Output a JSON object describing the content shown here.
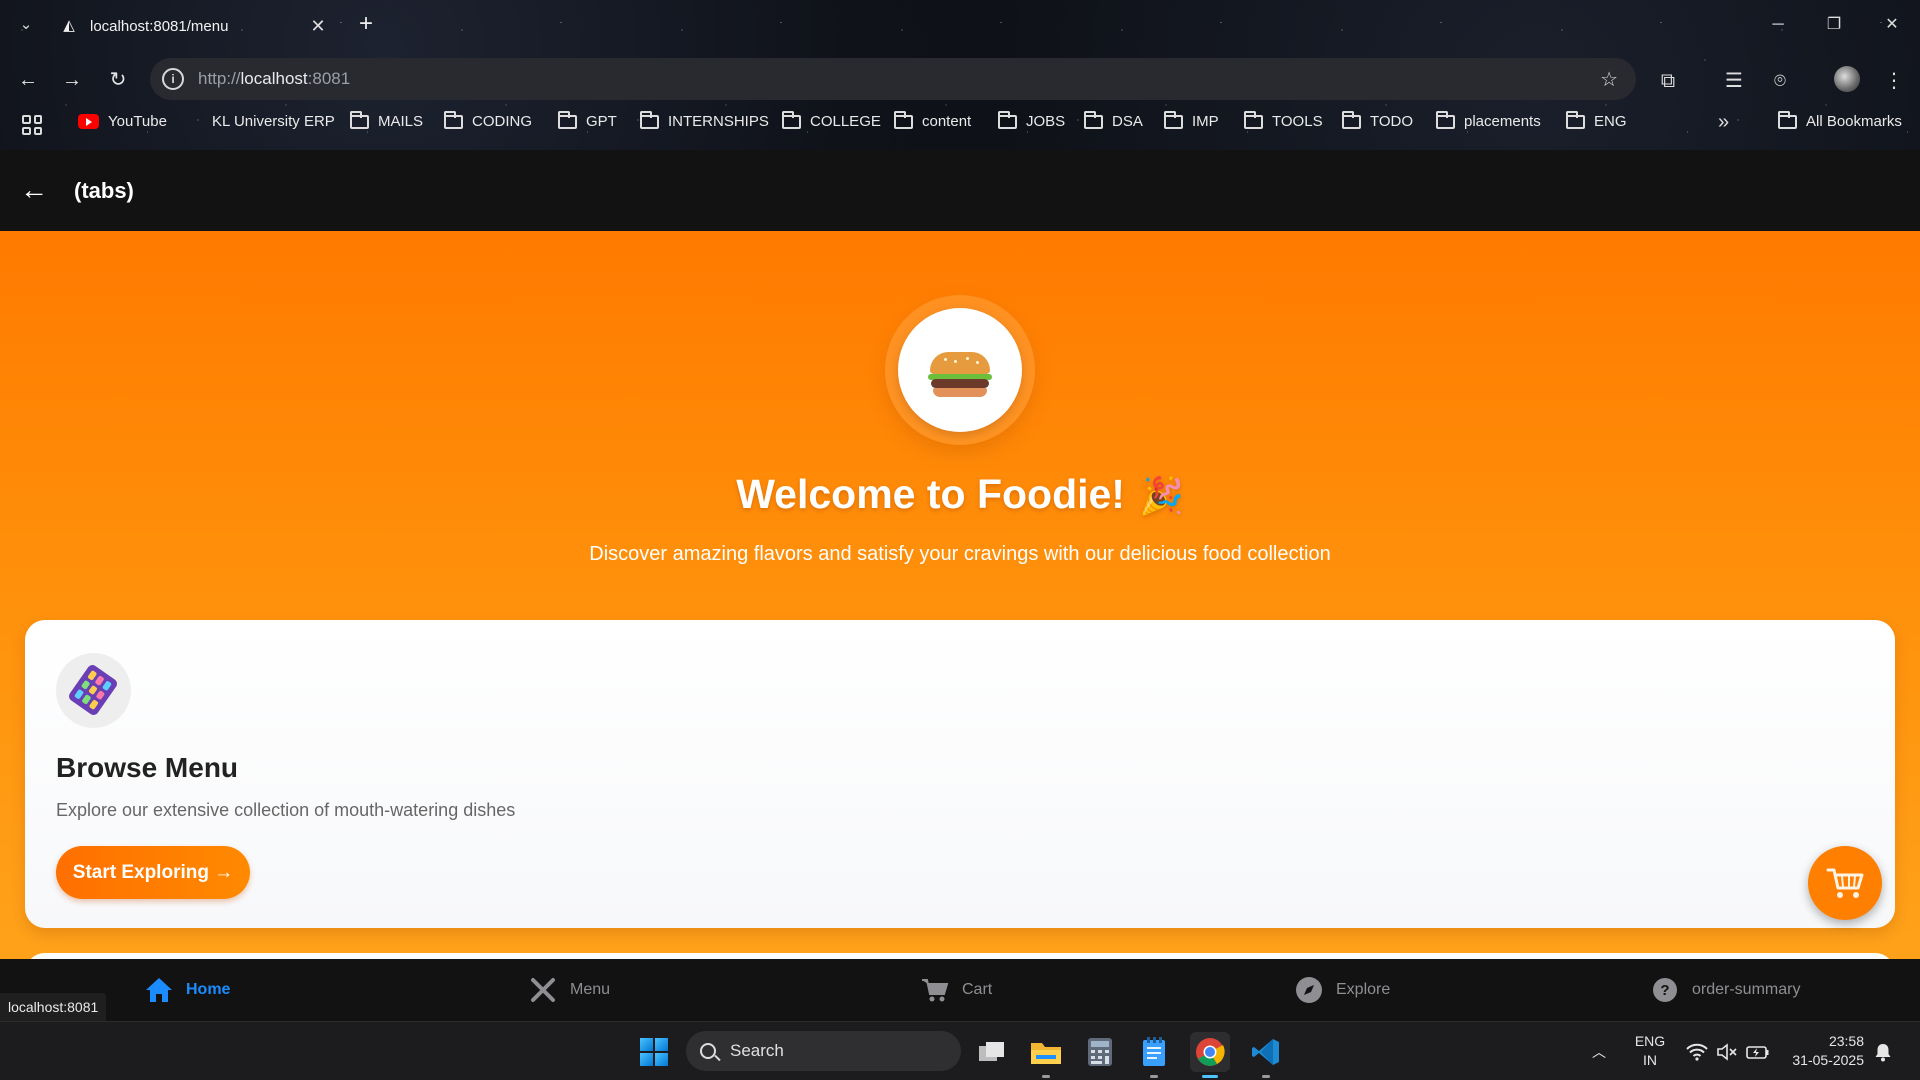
{
  "browser": {
    "tab_title": "localhost:8081/menu",
    "url_scheme": "http://",
    "url_host": "localhost",
    "url_port": ":8081",
    "status_url": "localhost:8081",
    "bookmarks": [
      {
        "label": "YouTube",
        "icon": "youtube-icon"
      },
      {
        "label": "KL University ERP",
        "icon": "microsoft-icon"
      },
      {
        "label": "MAILS",
        "icon": "folder-icon"
      },
      {
        "label": "CODING",
        "icon": "folder-icon"
      },
      {
        "label": "GPT",
        "icon": "folder-icon"
      },
      {
        "label": "INTERNSHIPS",
        "icon": "folder-icon"
      },
      {
        "label": "COLLEGE",
        "icon": "folder-icon"
      },
      {
        "label": "content",
        "icon": "folder-icon"
      },
      {
        "label": "JOBS",
        "icon": "folder-icon"
      },
      {
        "label": "DSA",
        "icon": "folder-icon"
      },
      {
        "label": "IMP",
        "icon": "folder-icon"
      },
      {
        "label": "TOOLS",
        "icon": "folder-icon"
      },
      {
        "label": "TODO",
        "icon": "folder-icon"
      },
      {
        "label": "placements",
        "icon": "folder-icon"
      },
      {
        "label": "ENG",
        "icon": "folder-icon"
      }
    ],
    "all_bookmarks_label": "All Bookmarks"
  },
  "app": {
    "header_title": "(tabs)",
    "welcome_title": "Welcome to Foodie!",
    "welcome_emoji": "🎉",
    "subtitle": "Discover amazing flavors and satisfy your cravings with our delicious food collection",
    "card": {
      "title": "Browse Menu",
      "description": "Explore our extensive collection of mouth-watering dishes",
      "button_label": "Start Exploring →"
    },
    "tabs": [
      {
        "label": "Home",
        "icon": "home-icon",
        "active": true
      },
      {
        "label": "Menu",
        "icon": "utensils-icon",
        "active": false
      },
      {
        "label": "Cart",
        "icon": "cart-icon",
        "active": false
      },
      {
        "label": "Explore",
        "icon": "compass-icon",
        "active": false
      },
      {
        "label": "order-summary",
        "icon": "help-icon",
        "active": false
      }
    ],
    "colors": {
      "primary_orange": "#ff7a00",
      "active_tab_blue": "#1a8cff",
      "header_bg": "#121212"
    }
  },
  "taskbar": {
    "search_label": "Search",
    "lang_line1": "ENG",
    "lang_line2": "IN",
    "time": "23:58",
    "date": "31-05-2025"
  }
}
